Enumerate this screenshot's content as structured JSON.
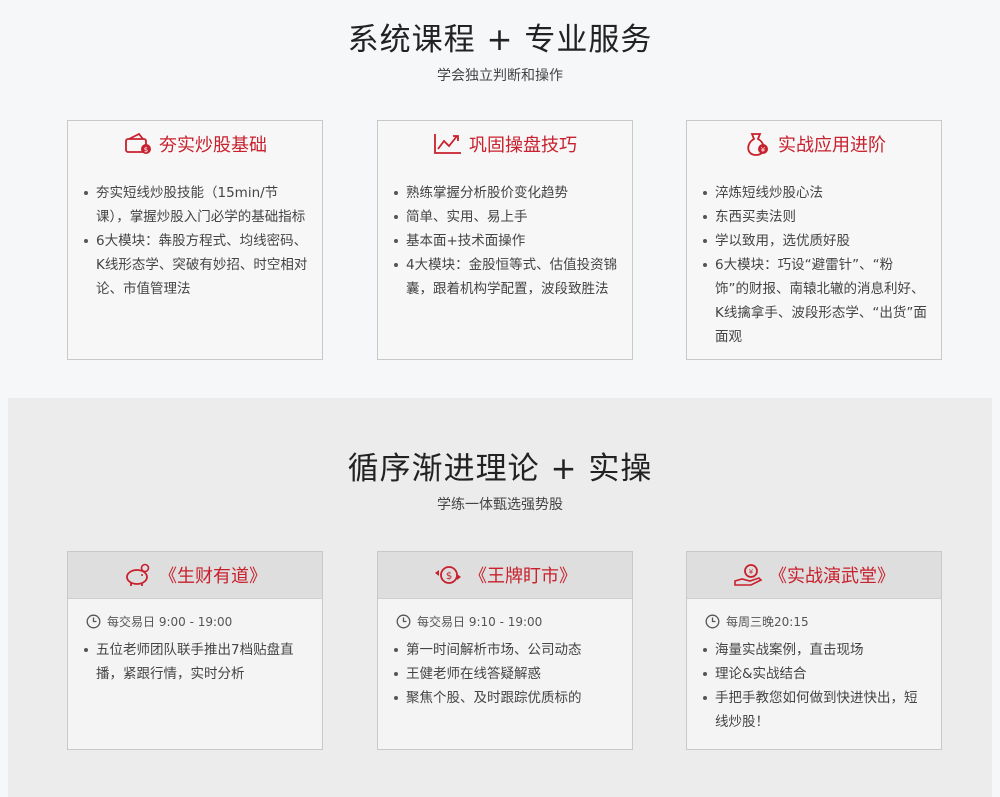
{
  "section1": {
    "title": "系统课程 + 专业服务",
    "subtitle": "学会独立判断和操作",
    "cards": [
      {
        "title": "夯实炒股基础",
        "icon": "wallet-icon",
        "items": [
          "夯实短线炒股技能（15min/节课），掌握炒股入门必学的基础指标",
          "6大模块：犇股方程式、均线密码、K线形态学、突破有妙招、时空相对论、市值管理法"
        ]
      },
      {
        "title": "巩固操盘技巧",
        "icon": "trend-chart-icon",
        "items": [
          "熟练掌握分析股价变化趋势",
          "简单、实用、易上手",
          "基本面+技术面操作",
          "4大模块：金股恒等式、估值投资锦囊，跟着机构学配置，波段致胜法"
        ]
      },
      {
        "title": "实战应用进阶",
        "icon": "money-bag-icon",
        "items": [
          "淬炼短线炒股心法",
          "东西买卖法则",
          "学以致用，选优质好股",
          "6大模块：巧设“避雷针”、“粉饰”的财报、南辕北辙的消息利好、K线擒拿手、波段形态学、“出货”面面观"
        ]
      }
    ]
  },
  "section2": {
    "title": "循序渐进理论 + 实操",
    "subtitle": "学练一体甄选强势股",
    "cards": [
      {
        "title": "《生财有道》",
        "icon": "piggy-bank-icon",
        "time": "每交易日 9:00 - 19:00",
        "items": [
          "五位老师团队联手推出7档贴盘直播，紧跟行情，实时分析"
        ]
      },
      {
        "title": "《王牌盯市》",
        "icon": "coin-exchange-icon",
        "time": "每交易日 9:10 - 19:00",
        "items": [
          "第一时间解析市场、公司动态",
          "王健老师在线答疑解惑",
          "聚焦个股、及时跟踪优质标的"
        ]
      },
      {
        "title": "《实战演武堂》",
        "icon": "hand-coin-icon",
        "time": "每周三晚20:15",
        "items": [
          "海量实战案例，直击现场",
          "理论&实战结合",
          "手把手教您如何做到快进快出，短线炒股！"
        ]
      }
    ]
  },
  "colors": {
    "accent": "#c8202c",
    "card_border": "#c9c9c9",
    "section2_bg": "#ececec"
  }
}
